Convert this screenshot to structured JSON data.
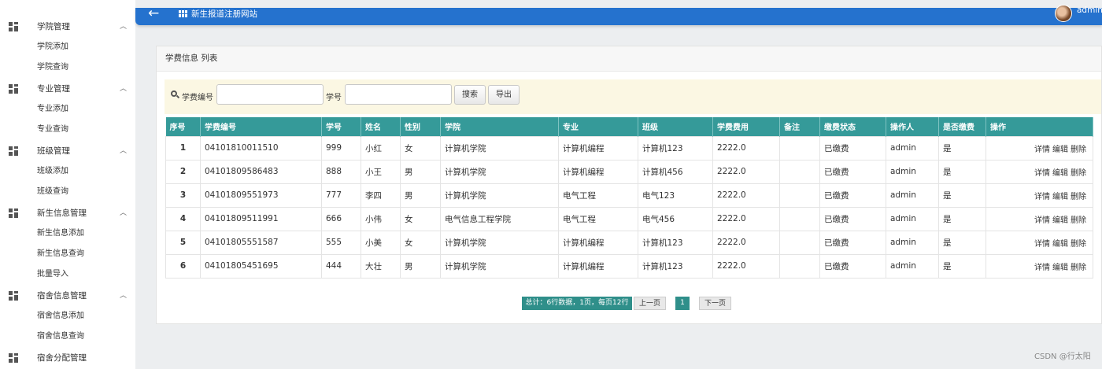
{
  "sidebar": {
    "groups": [
      {
        "title": "学院管理",
        "items": [
          "学院添加",
          "学院查询"
        ]
      },
      {
        "title": "专业管理",
        "items": [
          "专业添加",
          "专业查询"
        ]
      },
      {
        "title": "班级管理",
        "items": [
          "班级添加",
          "班级查询"
        ]
      },
      {
        "title": "新生信息管理",
        "items": [
          "新生信息添加",
          "新生信息查询",
          "批量导入"
        ]
      },
      {
        "title": "宿舍信息管理",
        "items": [
          "宿舍信息添加",
          "宿舍信息查询"
        ]
      },
      {
        "title": "宿舍分配管理",
        "items": []
      }
    ],
    "chevron": "︿"
  },
  "topbar": {
    "back_icon": "←",
    "title": "新生报道注册网站",
    "user": "admin"
  },
  "card": {
    "title": "学费信息 列表"
  },
  "search": {
    "fee_no_label": "学费编号",
    "student_no_label": "学号",
    "fee_no_value": "",
    "student_no_value": "",
    "search_button": "搜索",
    "export_button": "导出"
  },
  "table": {
    "headers": [
      "序号",
      "学费编号",
      "学号",
      "姓名",
      "性别",
      "学院",
      "专业",
      "班级",
      "学费费用",
      "备注",
      "缴费状态",
      "操作人",
      "是否缴费",
      "操作"
    ],
    "rows": [
      {
        "idx": "1",
        "fee_no": "04101810011510",
        "student_no": "999",
        "name": "小红",
        "gender": "女",
        "college": "计算机学院",
        "major": "计算机编程",
        "class": "计算机123",
        "fee": "2222.0",
        "remark": "",
        "status": "已缴费",
        "operator": "admin",
        "paid": "是"
      },
      {
        "idx": "2",
        "fee_no": "04101809586483",
        "student_no": "888",
        "name": "小王",
        "gender": "男",
        "college": "计算机学院",
        "major": "计算机编程",
        "class": "计算机456",
        "fee": "2222.0",
        "remark": "",
        "status": "已缴费",
        "operator": "admin",
        "paid": "是"
      },
      {
        "idx": "3",
        "fee_no": "04101809551973",
        "student_no": "777",
        "name": "李四",
        "gender": "男",
        "college": "计算机学院",
        "major": "电气工程",
        "class": "电气123",
        "fee": "2222.0",
        "remark": "",
        "status": "已缴费",
        "operator": "admin",
        "paid": "是"
      },
      {
        "idx": "4",
        "fee_no": "04101809511991",
        "student_no": "666",
        "name": "小伟",
        "gender": "女",
        "college": "电气信息工程学院",
        "major": "电气工程",
        "class": "电气456",
        "fee": "2222.0",
        "remark": "",
        "status": "已缴费",
        "operator": "admin",
        "paid": "是"
      },
      {
        "idx": "5",
        "fee_no": "04101805551587",
        "student_no": "555",
        "name": "小美",
        "gender": "女",
        "college": "计算机学院",
        "major": "计算机编程",
        "class": "计算机123",
        "fee": "2222.0",
        "remark": "",
        "status": "已缴费",
        "operator": "admin",
        "paid": "是"
      },
      {
        "idx": "6",
        "fee_no": "04101805451695",
        "student_no": "444",
        "name": "大壮",
        "gender": "男",
        "college": "计算机学院",
        "major": "计算机编程",
        "class": "计算机123",
        "fee": "2222.0",
        "remark": "",
        "status": "已缴费",
        "operator": "admin",
        "paid": "是"
      }
    ],
    "ops": [
      "详情",
      "编辑",
      "删除"
    ]
  },
  "pager": {
    "total": "总计：6行数据，1页，每页12行",
    "prev": "上一页",
    "current": "1",
    "next": "下一页"
  },
  "watermark": "CSDN @行太阳"
}
